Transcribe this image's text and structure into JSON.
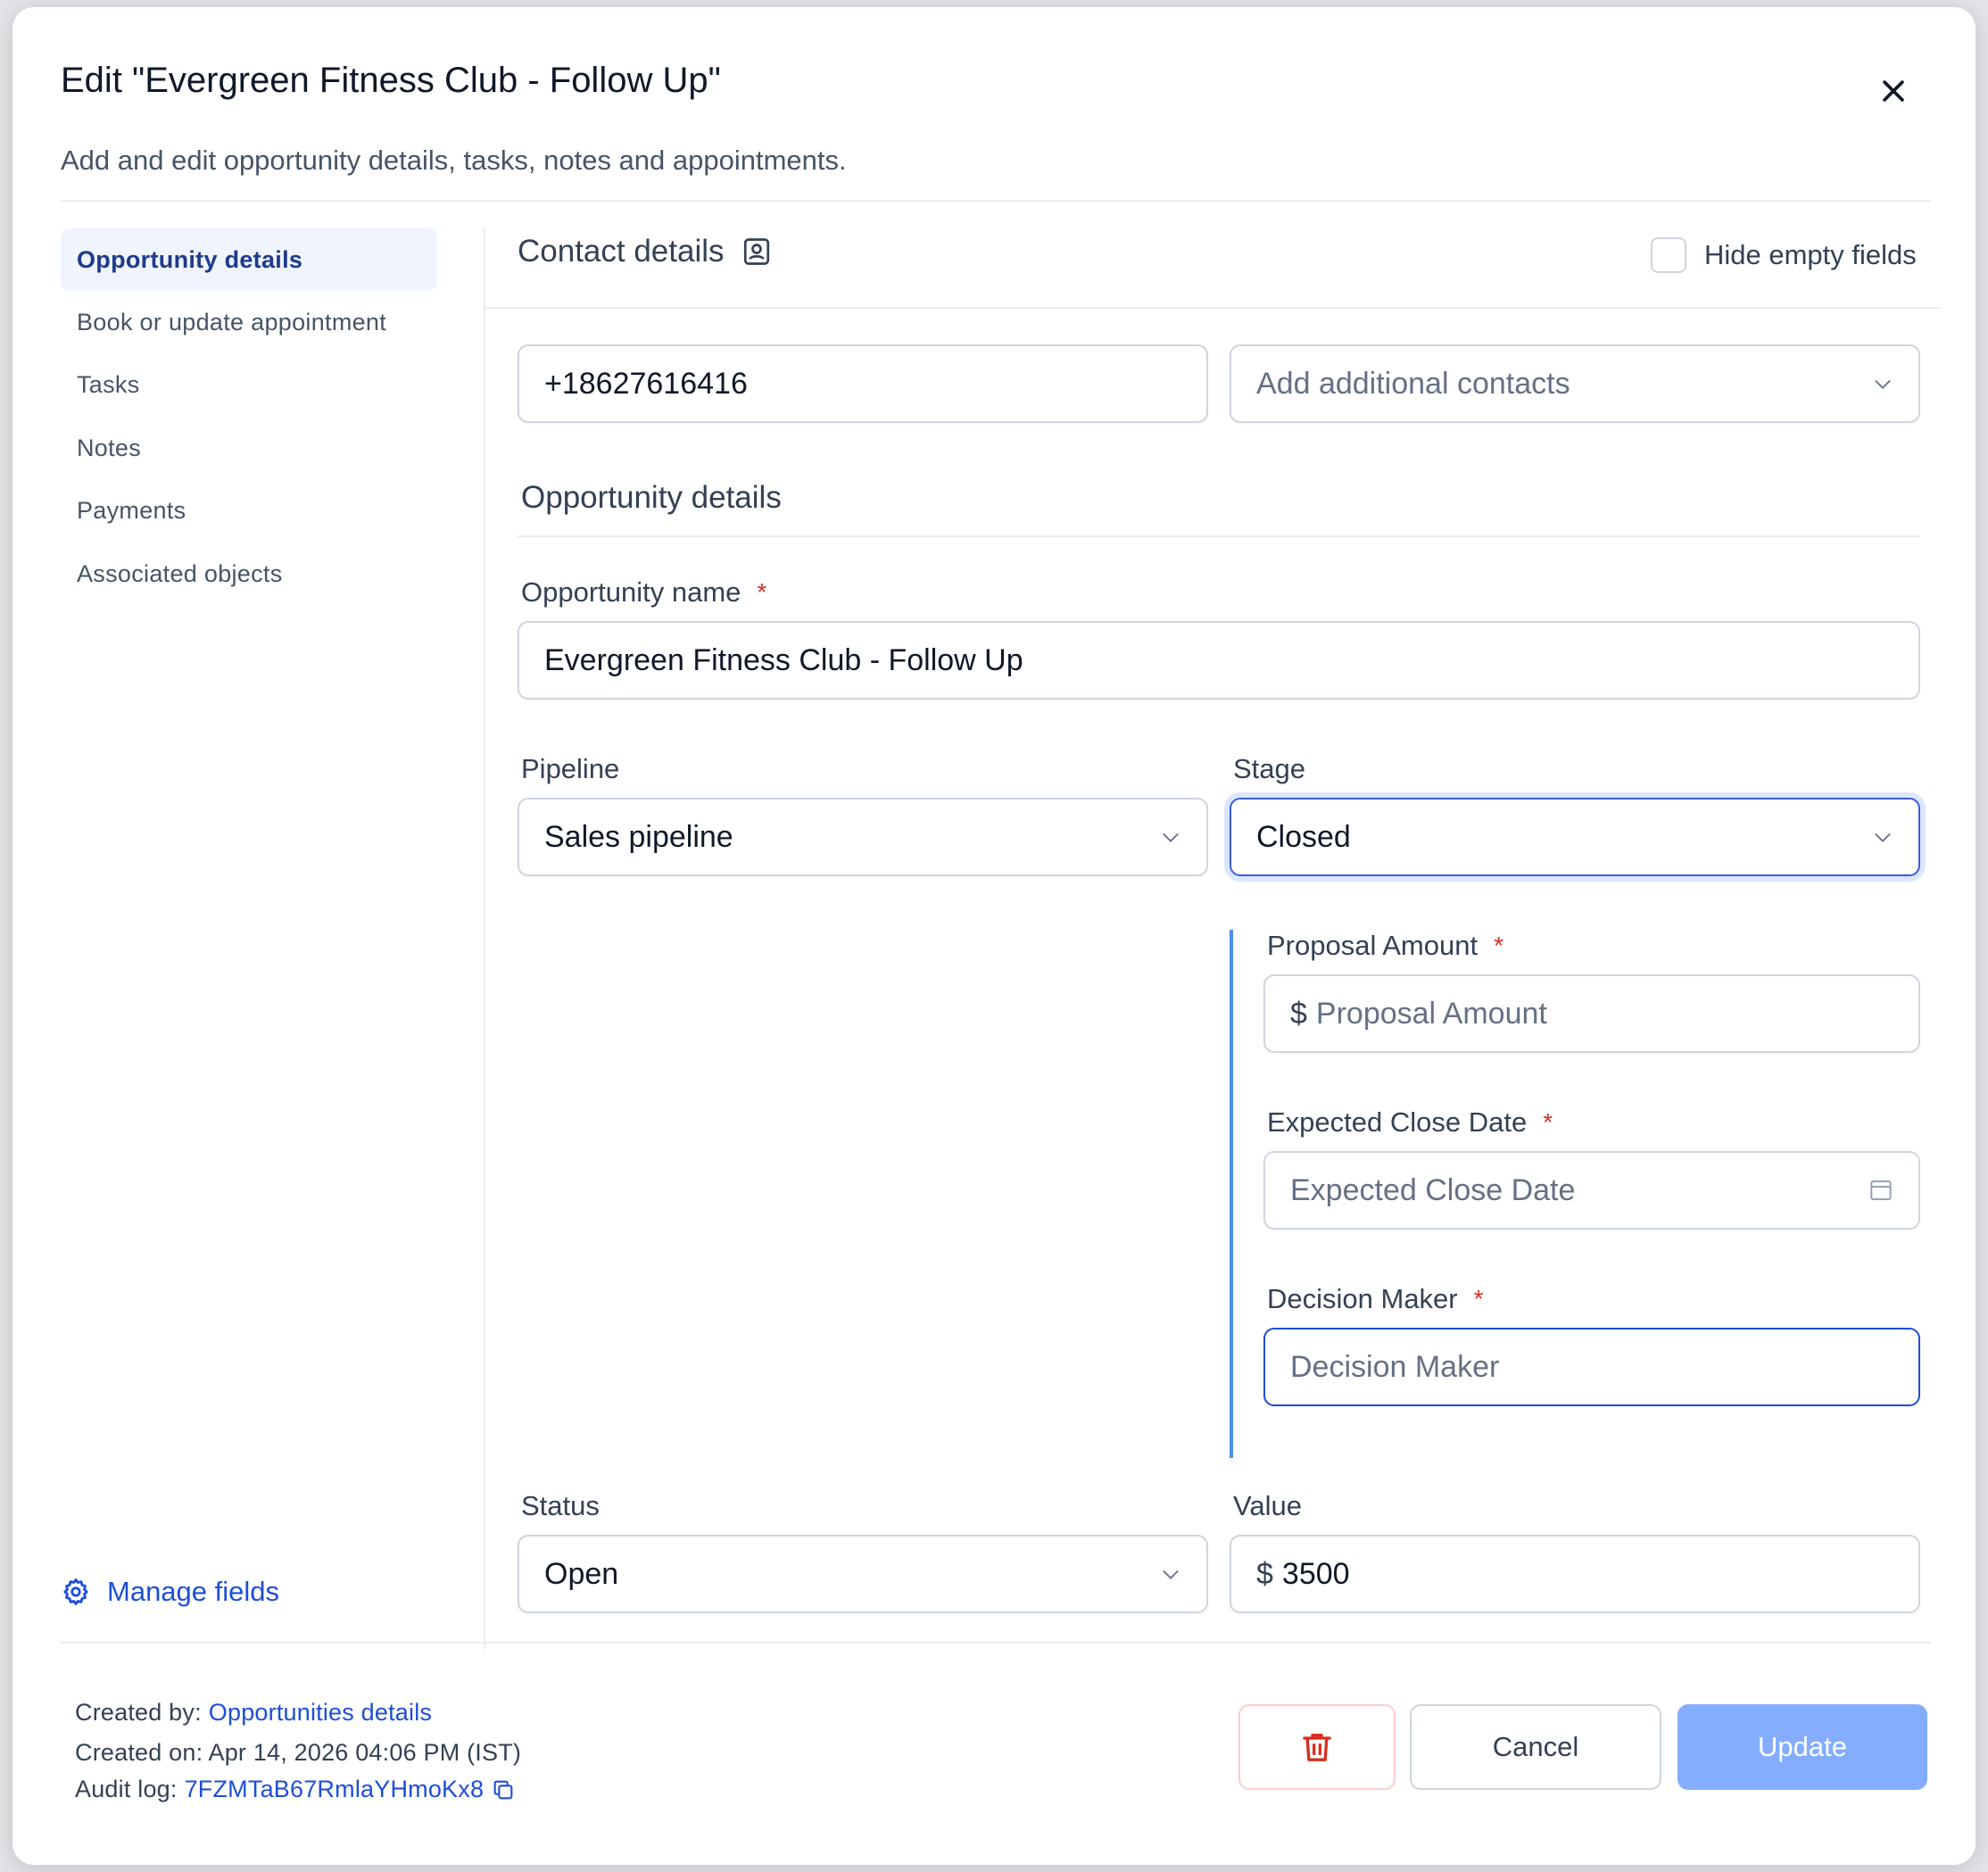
{
  "modal": {
    "title": "Edit \"Evergreen Fitness Club - Follow Up\"",
    "subtitle": "Add and edit opportunity details, tasks, notes and appointments."
  },
  "sidebar": {
    "items": [
      {
        "label": "Opportunity details",
        "active": true
      },
      {
        "label": "Book or update appointment"
      },
      {
        "label": "Tasks"
      },
      {
        "label": "Notes"
      },
      {
        "label": "Payments"
      },
      {
        "label": "Associated objects"
      }
    ],
    "manage_fields": "Manage fields"
  },
  "contact": {
    "heading": "Contact details",
    "hide_empty_label": "Hide empty fields",
    "hide_empty_checked": false,
    "phone": "+18627616416",
    "additional_placeholder": "Add additional contacts"
  },
  "opportunity": {
    "heading": "Opportunity details",
    "name_label": "Opportunity name",
    "name_value": "Evergreen Fitness Club - Follow Up",
    "pipeline_label": "Pipeline",
    "pipeline_value": "Sales pipeline",
    "stage_label": "Stage",
    "stage_value": "Closed",
    "proposal_label": "Proposal Amount",
    "proposal_prefix": "$",
    "proposal_placeholder": "Proposal Amount",
    "close_date_label": "Expected Close Date",
    "close_date_placeholder": "Expected Close Date",
    "decision_label": "Decision Maker",
    "decision_placeholder": "Decision Maker",
    "status_label": "Status",
    "status_value": "Open",
    "value_label": "Value",
    "value_prefix": "$",
    "value_value": "3500",
    "required_mark": "*"
  },
  "footer": {
    "created_by_label": "Created by:",
    "created_by_value": "Opportunities details",
    "created_on": "Created on: Apr 14, 2026 04:06 PM (IST)",
    "audit_label": "Audit log:",
    "audit_value": "7FZMTaB67RmlaYHmoKx8",
    "cancel": "Cancel",
    "update": "Update"
  },
  "colors": {
    "accent": "#1d4ed8",
    "update_button": "#84adff",
    "required": "#d92d20",
    "delete_icon": "#d92d20",
    "stage_accent_bar": "#4b8ef0"
  },
  "icons": [
    "close-icon",
    "contact-card-icon",
    "chevron-down-icon",
    "calendar-icon",
    "gear-icon",
    "trash-icon",
    "copy-icon"
  ]
}
